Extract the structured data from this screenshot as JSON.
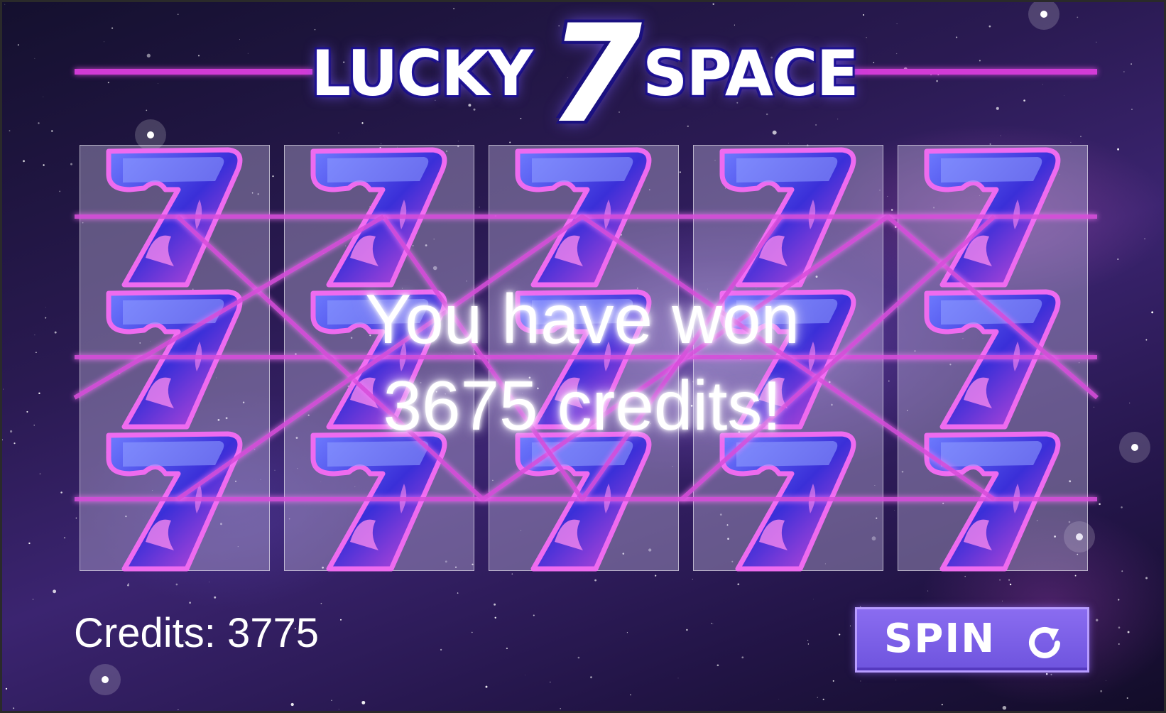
{
  "game": {
    "title_left": "LUCKY",
    "title_number": "7",
    "title_right": "SPACE"
  },
  "reels": {
    "count": 5,
    "rows": 3,
    "symbols": [
      [
        "seven",
        "seven",
        "seven"
      ],
      [
        "seven",
        "seven",
        "seven"
      ],
      [
        "seven",
        "seven",
        "seven"
      ],
      [
        "seven",
        "seven",
        "seven"
      ],
      [
        "seven",
        "seven",
        "seven"
      ]
    ]
  },
  "win_message": {
    "line1": "You have won",
    "line2": "3675 credits!"
  },
  "credits": {
    "text": "Credits: 3775"
  },
  "spin_button": {
    "label": "SPIN",
    "icon": "refresh-icon"
  },
  "colors": {
    "payline": "#d94fdc",
    "button": "#7a5fe8",
    "symbol_blue": "#3a34d8",
    "symbol_pink": "#e04ad8"
  }
}
